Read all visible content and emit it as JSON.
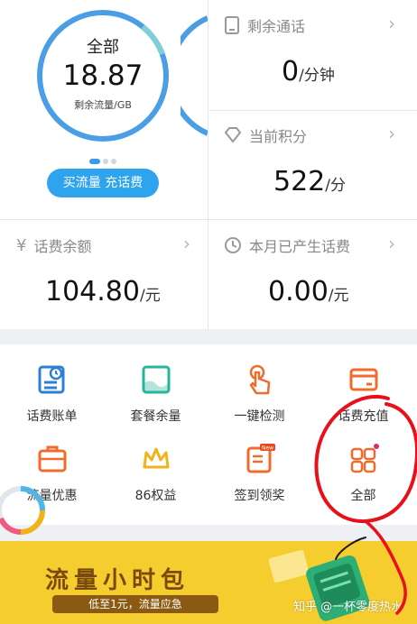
{
  "data_card": {
    "label": "全部",
    "value": "18.87",
    "unit": "剩余流量/GB",
    "buy_button": "买流量 充话费"
  },
  "remaining_calls": {
    "title": "剩余通话",
    "value": "0",
    "unit": "/分钟"
  },
  "points": {
    "title": "当前积分",
    "value": "522",
    "unit": "/分"
  },
  "balance": {
    "title": "话费余额",
    "value": "104.80",
    "unit": "/元"
  },
  "month_charges": {
    "title": "本月已产生话费",
    "value": "0.00",
    "unit": "/元"
  },
  "menu": {
    "items": [
      {
        "label": "话费账单",
        "icon": "bill-icon"
      },
      {
        "label": "套餐余量",
        "icon": "package-icon"
      },
      {
        "label": "一键检测",
        "icon": "tap-icon"
      },
      {
        "label": "话费充值",
        "icon": "card-icon"
      },
      {
        "label": "流量优惠",
        "icon": "briefcase-icon"
      },
      {
        "label": "86权益",
        "icon": "crown-icon"
      },
      {
        "label": "签到领奖",
        "icon": "checkin-icon"
      },
      {
        "label": "全部",
        "icon": "grid-icon"
      }
    ],
    "badge_new": "New"
  },
  "banner": {
    "title": "流量小时包",
    "subtitle": "低至1元，流量应急"
  },
  "watermark": "知乎 @一杯零度热水",
  "colors": {
    "accent": "#2ea3ee",
    "gauge_track": "#5aa7e8",
    "icon_blue": "#2c7fd6",
    "icon_green": "#24b59b",
    "icon_orange": "#f06b2d",
    "icon_yellow": "#f2b21a",
    "annotation_red": "#e8101a",
    "banner_bg": "#f6cd2e"
  }
}
